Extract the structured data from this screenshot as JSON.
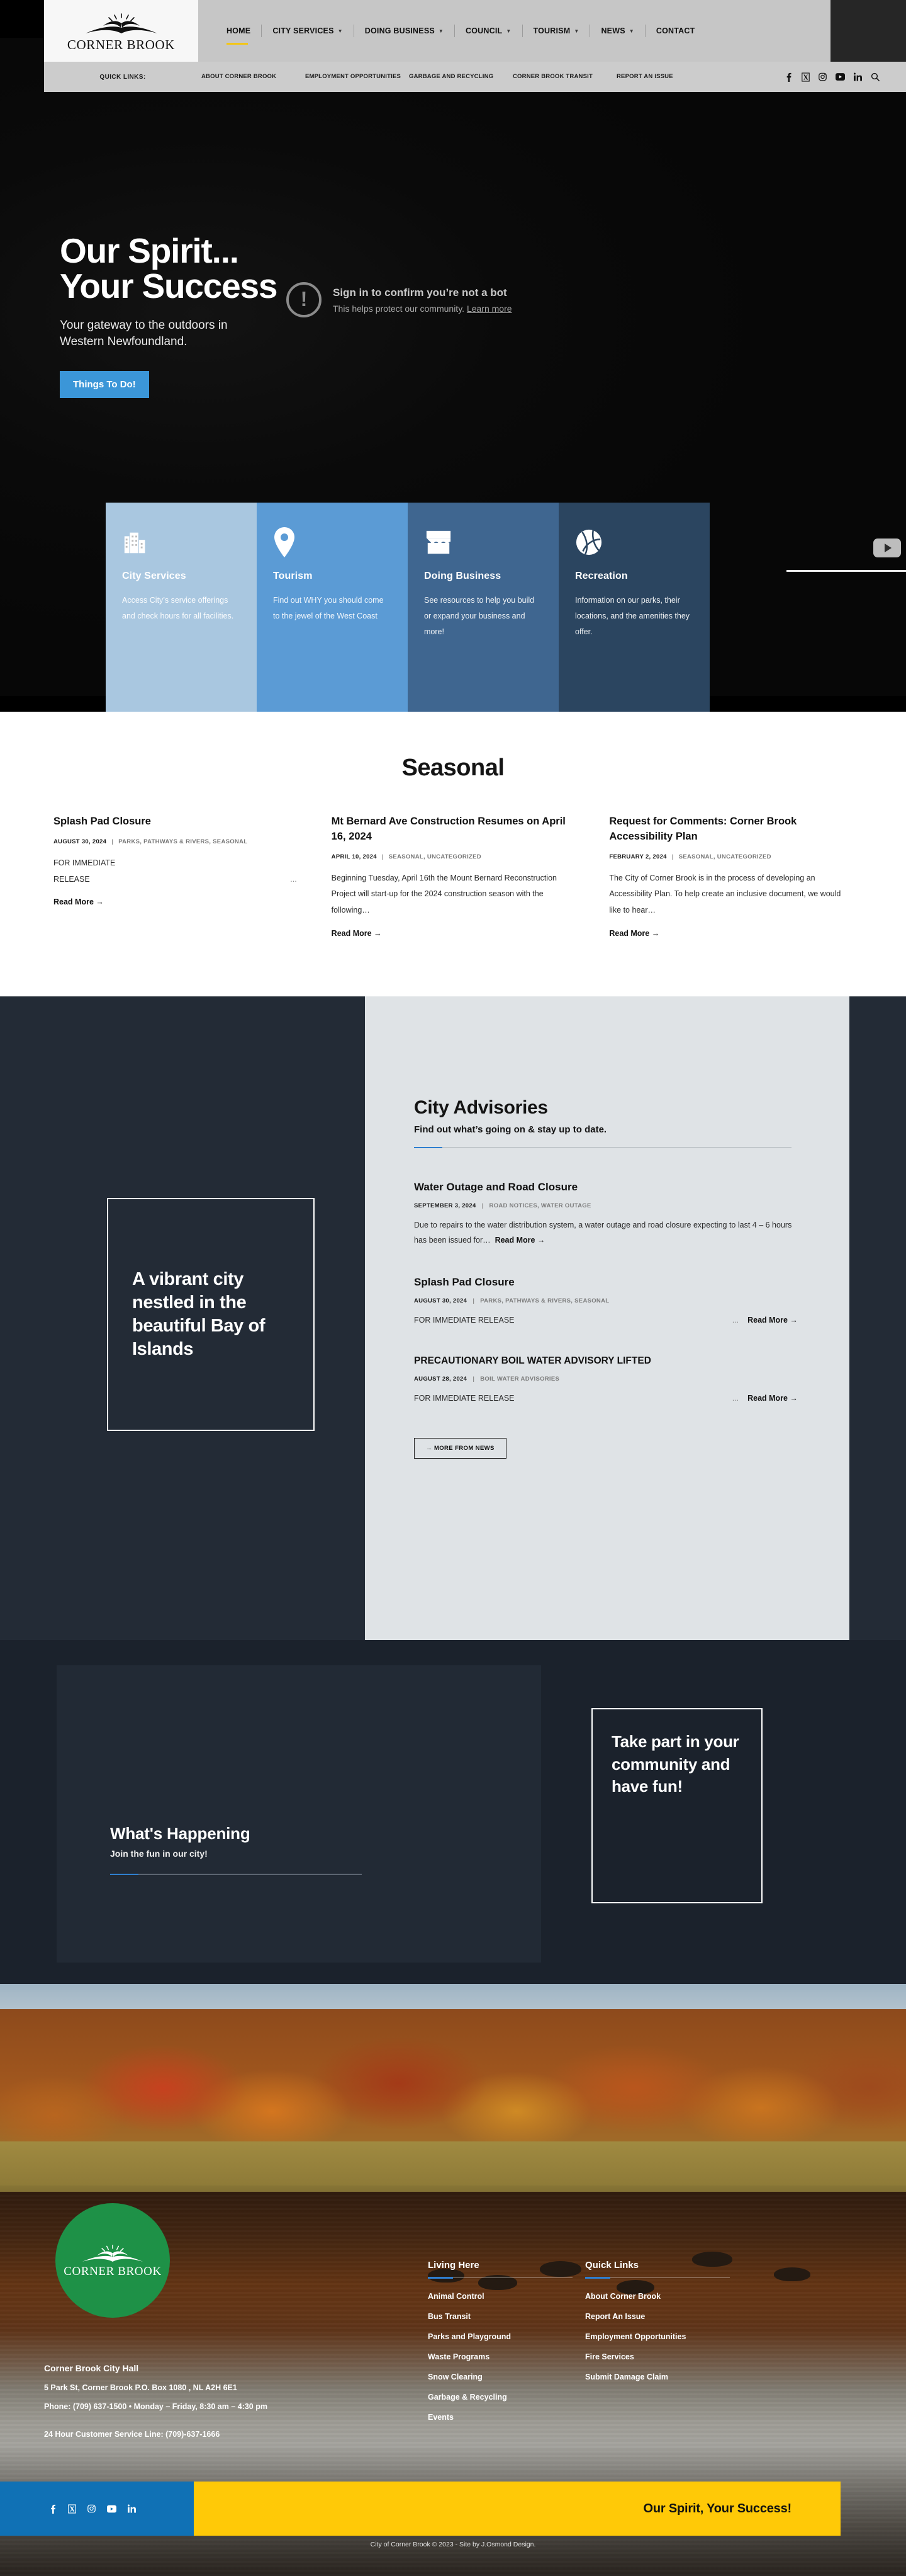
{
  "header": {
    "logo_text": "CORNER BROOK",
    "nav": [
      {
        "label": "HOME",
        "has_caret": false,
        "active": true
      },
      {
        "label": "CITY SERVICES",
        "has_caret": true,
        "active": false
      },
      {
        "label": "DOING BUSINESS",
        "has_caret": true,
        "active": false
      },
      {
        "label": "COUNCIL",
        "has_caret": true,
        "active": false
      },
      {
        "label": "TOURISM",
        "has_caret": true,
        "active": false
      },
      {
        "label": "NEWS",
        "has_caret": true,
        "active": false
      },
      {
        "label": "CONTACT",
        "has_caret": false,
        "active": false
      }
    ],
    "quick_links_label": "QUICK LINKS:",
    "quick_links": [
      "ABOUT CORNER BROOK",
      "EMPLOYMENT OPPORTUNITIES",
      "GARBAGE AND RECYCLING",
      "CORNER BROOK TRANSIT",
      "REPORT AN ISSUE"
    ],
    "social": [
      "facebook-icon",
      "x-twitter-icon",
      "instagram-icon",
      "youtube-icon",
      "linkedin-icon"
    ],
    "search": "search-icon"
  },
  "hero": {
    "title_line1": "Our Spirit...",
    "title_line2": "Your Success",
    "subtitle_line1": "Your gateway to the outdoors in",
    "subtitle_line2": "Western Newfoundland.",
    "cta": "Things To Do!",
    "youtube_overlay": {
      "title": "Sign in to confirm you’re not a bot",
      "desc_before": "This helps protect our community. ",
      "desc_link": "Learn more",
      "warn_glyph": "!"
    }
  },
  "cards": [
    {
      "icon": "city-buildings-icon",
      "title": "City Services",
      "desc": "Access City’s service offerings and check hours for all facilities.",
      "color": "#a9c7e0"
    },
    {
      "icon": "map-pin-icon",
      "title": "Tourism",
      "desc": "Find out WHY you should come to the jewel of the West Coast",
      "color": "#5b9bd5"
    },
    {
      "icon": "storefront-icon",
      "title": "Doing Business",
      "desc": "See resources to help you build or expand your business and more!",
      "color": "#3f6690"
    },
    {
      "icon": "volleyball-icon",
      "title": "Recreation",
      "desc": "Information on our parks, their locations, and the amenities they offer.",
      "color": "#2b4560"
    }
  ],
  "seasonal": {
    "heading": "Seasonal",
    "posts": [
      {
        "title": "Splash Pad Closure",
        "date": "AUGUST 30, 2024",
        "cats": "PARKS, PATHWAYS & RIVERS, SEASONAL",
        "excerpt_line1": "FOR IMMEDIATE",
        "excerpt_line2": "RELEASE",
        "dots": "...",
        "read_more": "Read More →"
      },
      {
        "title": "Mt Bernard Ave Construction Resumes on April 16, 2024",
        "date": "APRIL 10, 2024",
        "cats": "SEASONAL, UNCATEGORIZED",
        "excerpt": "Beginning Tuesday, April 16th the Mount Bernard Reconstruction Project will start-up for the 2024 construction season with the following…",
        "read_more": "Read More →"
      },
      {
        "title": "Request for Comments: Corner Brook Accessibility Plan",
        "date": "FEBRUARY 2, 2024",
        "cats": "SEASONAL, UNCATEGORIZED",
        "excerpt": "The City of Corner Brook is in the process of developing an Accessibility Plan. To help create an inclusive document, we would like to hear…",
        "read_more": "Read More →"
      }
    ]
  },
  "advisories": {
    "heading": "City Advisories",
    "subheading": "Find out what’s going on & stay up to date.",
    "items": [
      {
        "title": "Water Outage and Road Closure",
        "date": "SEPTEMBER 3, 2024",
        "cats": "ROAD NOTICES, WATER OUTAGE",
        "excerpt": "Due to repairs to the water distribution system, a water outage and road closure expecting to last 4 – 6 hours has been issued for…",
        "read_more": "Read More →"
      },
      {
        "title": "Splash Pad Closure",
        "date": "AUGUST 30, 2024",
        "cats": "PARKS, PATHWAYS & RIVERS, SEASONAL",
        "excerpt": "FOR IMMEDIATE RELEASE",
        "dots": "...",
        "read_more": "Read More →"
      },
      {
        "title": "PRECAUTIONARY BOIL WATER ADVISORY LIFTED",
        "date": "AUGUST 28, 2024",
        "cats": "BOIL WATER ADVISORIES",
        "excerpt": "FOR IMMEDIATE RELEASE",
        "dots": "...",
        "read_more": "Read More →"
      }
    ],
    "more_button": "→  MORE FROM NEWS",
    "vibrant_quote": "A vibrant city nestled in the beautiful Bay of Islands"
  },
  "happening": {
    "heading": "What's Happening",
    "subheading": "Join the fun in our city!",
    "take_part": "Take part in your community and have fun!"
  },
  "footer": {
    "logo_text": "CORNER BROOK",
    "address_heading": "Corner Brook City Hall",
    "address_line": "5 Park St, Corner Brook P.O. Box 1080 , NL A2H 6E1",
    "phone_line": "Phone: (709) 637-1500 • Monday – Friday, 8:30 am – 4:30 pm",
    "service_line": "24 Hour Customer Service Line: (709)-637-1666",
    "columns": [
      {
        "heading": "Living Here",
        "links": [
          "Animal Control",
          "Bus Transit",
          "Parks and Playground",
          "Waste Programs",
          "Snow Clearing",
          "Garbage & Recycling",
          "Events"
        ]
      },
      {
        "heading": "Quick Links",
        "links": [
          "About Corner Brook",
          "Report An Issue",
          "Employment Opportunities",
          "Fire Services",
          "Submit Damage Claim"
        ]
      }
    ],
    "social": [
      "facebook-icon",
      "x-twitter-icon",
      "instagram-icon",
      "youtube-icon",
      "linkedin-icon"
    ],
    "slogan": "Our Spirit, Your Success!",
    "copyright": "City of Corner Brook © 2023 - Site by J.Osmond Design."
  },
  "colors": {
    "accent_blue": "#2f7fd0",
    "cta_blue": "#3b96d8",
    "yellow": "#ffc907",
    "dark_navy": "#232b36",
    "green": "#1e9147"
  }
}
